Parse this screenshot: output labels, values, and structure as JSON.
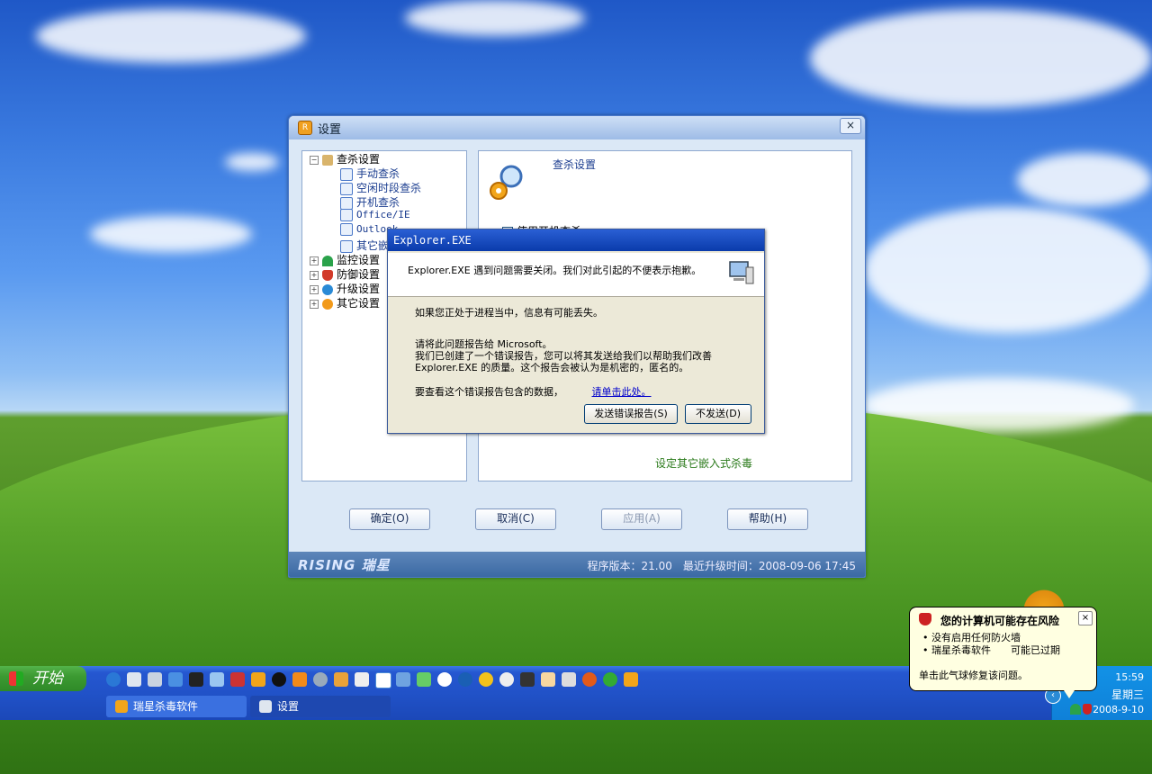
{
  "settings_window": {
    "title": "设置",
    "close_label": "×",
    "tree": [
      {
        "label": "查杀设置",
        "expander": "−",
        "child": false
      },
      {
        "label": "手动查杀",
        "child": true
      },
      {
        "label": "空闲时段查杀",
        "child": true
      },
      {
        "label": "开机查杀",
        "child": true
      },
      {
        "label": "Office/IE",
        "child": true
      },
      {
        "label": "Outlook",
        "child": true
      },
      {
        "label": "其它嵌入式",
        "child": true
      },
      {
        "label": "监控设置",
        "expander": "+",
        "child": false
      },
      {
        "label": "防御设置",
        "expander": "+",
        "child": false
      },
      {
        "label": "升级设置",
        "expander": "+",
        "child": false
      },
      {
        "label": "其它设置",
        "expander": "+",
        "child": false
      }
    ],
    "panel": {
      "title": "查杀设置",
      "checkbox_label": "使用开机查杀",
      "link_label": "设定其它嵌入式杀毒"
    },
    "buttons": {
      "ok": "确定(O)",
      "cancel": "取消(C)",
      "apply": "应用(A)",
      "help": "帮助(H)"
    },
    "status": {
      "logo": "RISING 瑞星",
      "version": "程序版本：21.00　最近升级时间：2008-09-06 17:45"
    }
  },
  "error_dialog": {
    "title": "Explorer.EXE",
    "header_text": "Explorer.EXE 遇到问题需要关闭。我们对此引起的不便表示抱歉。",
    "line1": "如果您正处于进程当中，信息有可能丢失。",
    "line2": "请将此问题报告给 Microsoft。",
    "line3": "我们已创建了一个错误报告，您可以将其发送给我们以帮助我们改善 Explorer.EXE 的质量。这个报告会被认为是机密的，匿名的。",
    "line4": "要查看这个错误报告包含的数据，",
    "link": "请单击此处。",
    "send_button": "发送错误报告(S)",
    "dont_send_button": "不发送(D)"
  },
  "taskbar": {
    "start_label": "开始",
    "tasks": [
      {
        "label": "瑞星杀毒软件",
        "active": false
      },
      {
        "label": "设置",
        "active": true
      }
    ],
    "tray": {
      "time": "15:59",
      "weekday": "星期三",
      "date": "2008-9-10"
    }
  },
  "balloon": {
    "title": "您的计算机可能存在风险",
    "items": [
      "• 没有启用任何防火墙",
      "• 瑞星杀毒软件　　可能已过期"
    ],
    "footer": "单击此气球修复该问题。",
    "close_label": "×"
  },
  "colors": {
    "xp_title_blue": "#0a3bab",
    "taskbar_blue": "#2152c8",
    "start_green": "#3c9a32",
    "balloon_yellow": "#ffffe1"
  }
}
